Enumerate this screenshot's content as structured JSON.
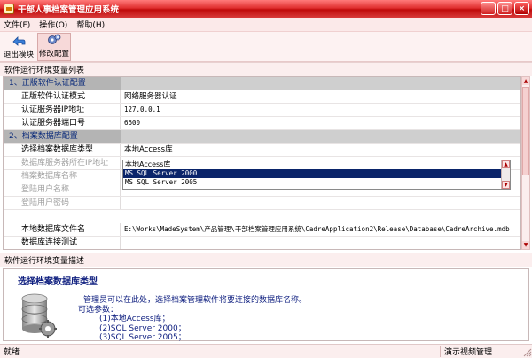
{
  "window": {
    "title": "干部人事档案管理应用系统",
    "minimize": "_",
    "maximize": "□",
    "close": "×"
  },
  "menu": [
    {
      "label": "文件(F)"
    },
    {
      "label": "操作(O)"
    },
    {
      "label": "帮助(H)"
    }
  ],
  "toolbar": {
    "exit_label": "退出模块",
    "config_label": "修改配置"
  },
  "grid_caption": "软件运行环境变量列表",
  "grid": {
    "rows": [
      {
        "type": "group",
        "key": "1、正版软件认证配置",
        "value": ""
      },
      {
        "type": "prop",
        "key": "正版软件认证模式",
        "value": "网络服务器认证"
      },
      {
        "type": "prop",
        "key": "认证服务器IP地址",
        "value": "127.0.0.1"
      },
      {
        "type": "prop",
        "key": "认证服务器端口号",
        "value": "6600"
      },
      {
        "type": "group",
        "key": "2、档案数据库配置",
        "value": ""
      },
      {
        "type": "prop",
        "key": "选择档案数据库类型",
        "value": "本地Access库"
      },
      {
        "type": "disabled",
        "key": "数据库服务器所在IP地址",
        "value": ""
      },
      {
        "type": "disabled",
        "key": "档案数据库名称",
        "value": ""
      },
      {
        "type": "disabled",
        "key": "登陆用户名称",
        "value": ""
      },
      {
        "type": "disabled",
        "key": "登陆用户密码",
        "value": ""
      },
      {
        "type": "prop",
        "key": "本地数据库文件名",
        "value": "E:\\Works\\MadeSystem\\产品管理\\干部档案管理应用系统\\CadreApplication2\\Release\\Database\\CadreArchive.mdb"
      },
      {
        "type": "prop",
        "key": "数据库连接测试",
        "value": ""
      }
    ]
  },
  "dropdown": {
    "options": [
      "本地Access库",
      "MS SQL Server 2000",
      "MS SQL Server 2005"
    ],
    "selected_index": 1
  },
  "desc_caption": "软件运行环境变量描述",
  "description": {
    "title": "选择档案数据库类型",
    "lines": [
      "管理员可以在此处，选择档案管理软件将要连接的数据库名称。",
      "可选参数：",
      "(1)本地Access库；",
      "(2)SQL Server 2000；",
      "(3)SQL Server 2005；"
    ]
  },
  "status": {
    "left": "就绪",
    "right": "演示视频管理"
  },
  "colors": {
    "title_red": "#c00a0a",
    "selection_blue": "#0a246a",
    "group_gray": "#b4b4b4",
    "desc_text": "#102080"
  }
}
